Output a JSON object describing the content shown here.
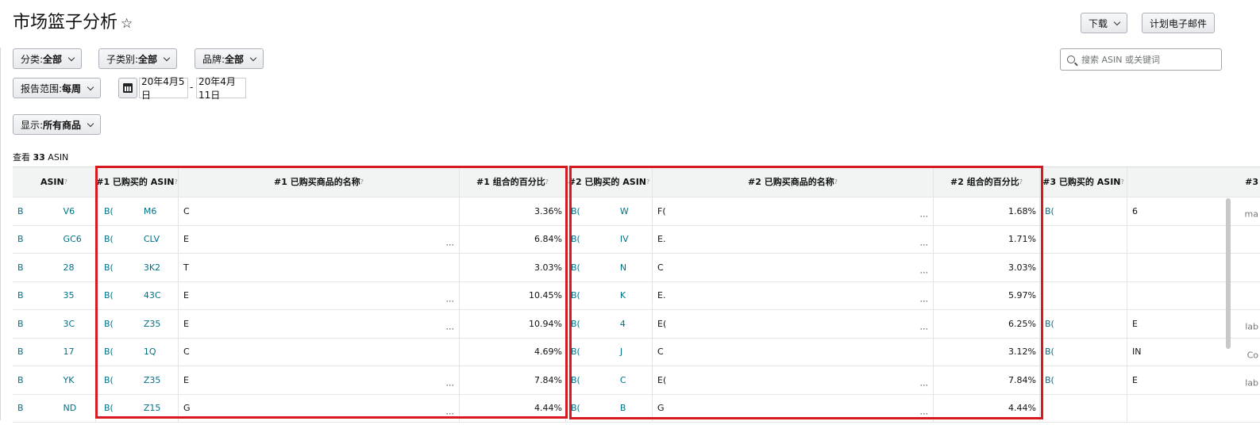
{
  "header": {
    "title": "市场篮子分析",
    "star": "☆",
    "download_label": "下载",
    "schedule_email_label": "计划电子邮件"
  },
  "filters": {
    "category": {
      "label": "分类: ",
      "value": "全部"
    },
    "subcategory": {
      "label": "子类别: ",
      "value": "全部"
    },
    "brand": {
      "label": "品牌: ",
      "value": "全部"
    },
    "report_range": {
      "label": "报告范围: ",
      "value": "每周"
    },
    "date_start": "20年4月5日",
    "date_sep": "-",
    "date_end": "20年4月11日",
    "display": {
      "label": "显示: ",
      "value": "所有商品"
    }
  },
  "search": {
    "placeholder": "搜索 ASIN 或关键词"
  },
  "results": {
    "prefix": "查看 ",
    "count": "33",
    "suffix": " ASIN"
  },
  "table": {
    "headers": [
      "ASIN",
      "#1 已购买的 ASIN",
      "#1 已购买商品的名称",
      "#1 组合的百分比",
      "#2 已购买的 ASIN",
      "#2 已购买商品的名称",
      "#2 组合的百分比",
      "#3 已购买的 ASIN",
      "#3"
    ],
    "rows": [
      {
        "asin_a": "B",
        "asin_b": "V6",
        "p1a": "B(",
        "p1b": "M6",
        "n1": "C",
        "n1e": "",
        "c1": "3.36%",
        "p2a": "B(",
        "p2b": "W",
        "n2": "F(",
        "n2e": "...",
        "c2": "1.68%",
        "p3": "B(",
        "n3": "6",
        "n3e": "ma"
      },
      {
        "asin_a": "B",
        "asin_b": "GC6",
        "p1a": "B(",
        "p1b": "CLV",
        "n1": "E",
        "n1e": "...",
        "c1": "6.84%",
        "p2a": "B(",
        "p2b": "IV",
        "n2": "E.",
        "n2e": "...",
        "c2": "1.71%",
        "p3": "",
        "n3": "",
        "n3e": ""
      },
      {
        "asin_a": "B",
        "asin_b": "28",
        "p1a": "B(",
        "p1b": "3K2",
        "n1": "T",
        "n1e": "",
        "c1": "3.03%",
        "p2a": "B(",
        "p2b": "N",
        "n2": "C",
        "n2e": "...",
        "c2": "3.03%",
        "p3": "",
        "n3": "",
        "n3e": ""
      },
      {
        "asin_a": "B",
        "asin_b": "35",
        "p1a": "B(",
        "p1b": "43C",
        "n1": "E",
        "n1e": "...",
        "c1": "10.45%",
        "p2a": "B(",
        "p2b": "K",
        "n2": "E.",
        "n2e": "...",
        "c2": "5.97%",
        "p3": "",
        "n3": "",
        "n3e": ""
      },
      {
        "asin_a": "B",
        "asin_b": "3C",
        "p1a": "B(",
        "p1b": "Z35",
        "n1": "E",
        "n1e": "...",
        "c1": "10.94%",
        "p2a": "B(",
        "p2b": "4",
        "n2": "E(",
        "n2e": "...",
        "c2": "6.25%",
        "p3": "B(",
        "n3": "E",
        "n3e": "lab"
      },
      {
        "asin_a": "B",
        "asin_b": "17",
        "p1a": "B(",
        "p1b": "1Q",
        "n1": "C",
        "n1e": "",
        "c1": "4.69%",
        "p2a": "B(",
        "p2b": "J",
        "n2": "C",
        "n2e": "",
        "c2": "3.12%",
        "p3": "B(",
        "n3": "IN",
        "n3e": "Co"
      },
      {
        "asin_a": "B",
        "asin_b": "YK",
        "p1a": "B(",
        "p1b": "Z35",
        "n1": "E",
        "n1e": "...",
        "c1": "7.84%",
        "p2a": "B(",
        "p2b": "C",
        "n2": "E(",
        "n2e": "...",
        "c2": "7.84%",
        "p3": "B(",
        "n3": "E",
        "n3e": "lab"
      },
      {
        "asin_a": "B",
        "asin_b": "ND",
        "p1a": "B(",
        "p1b": "Z15",
        "n1": "G",
        "n1e": "...",
        "c1": "4.44%",
        "p2a": "B(",
        "p2b": "B",
        "n2": "G",
        "n2e": "...",
        "c2": "4.44%",
        "p3": "",
        "n3": "",
        "n3e": ""
      }
    ]
  },
  "colors": {
    "link": "#007185",
    "highlight": "#d71920",
    "header_bg": "#f2f4f4"
  },
  "icons": {
    "calendar": "calendar-icon",
    "search": "search-icon",
    "star": "star-icon",
    "chevron": "chevron-down-icon"
  }
}
